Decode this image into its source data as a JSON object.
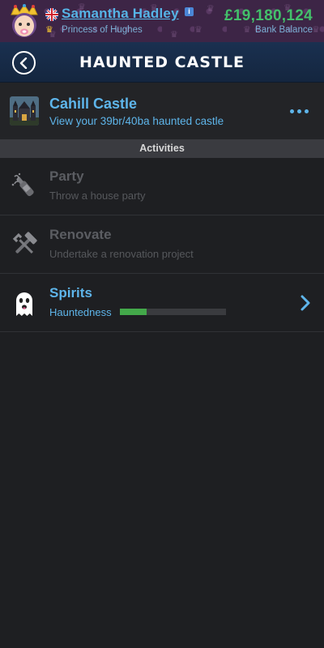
{
  "header": {
    "player_name": "Samantha Hadley",
    "player_title": "Princess of Hughes",
    "bank_amount": "£19,180,124",
    "bank_label": "Bank Balance",
    "flag_icon": "uk-flag-icon",
    "title_icon": "crown-icon",
    "info_icon_text": "i"
  },
  "nav": {
    "title": "HAUNTED CASTLE",
    "back_icon": "chevron-left-icon"
  },
  "castle": {
    "name": "Cahill Castle",
    "description": "View your 39br/40ba haunted castle",
    "more_icon": "ellipsis-icon"
  },
  "activities_header": "Activities",
  "activities": [
    {
      "label": "Party",
      "sub": "Throw a house party",
      "icon": "champagne-icon",
      "enabled": false
    },
    {
      "label": "Renovate",
      "sub": "Undertake a renovation project",
      "icon": "tools-icon",
      "enabled": false
    },
    {
      "label": "Spirits",
      "sub": "Hauntedness",
      "icon": "ghost-icon",
      "enabled": true,
      "hauntedness_percent": 25
    }
  ],
  "colors": {
    "accent": "#5eb5ea",
    "money": "#43c06a",
    "header_bg": "#3d2546",
    "nav_bg": "#1a3050",
    "progress": "#43a84a"
  }
}
